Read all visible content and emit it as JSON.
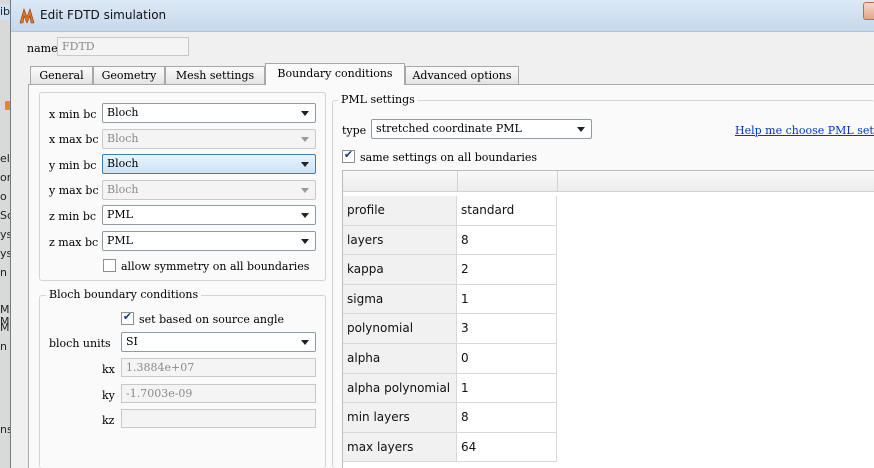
{
  "background_app": {
    "fragments": [
      "ib",
      "el",
      "ore",
      "o",
      "Sc",
      "ys",
      "ys",
      "n",
      "Mo",
      "Mo",
      "M",
      "n",
      "ns"
    ]
  },
  "window": {
    "title": "Edit FDTD simulation",
    "icon": "lumerical-logo-icon",
    "accent": "#e8741e"
  },
  "name_field": {
    "label": "name",
    "value": "FDTD"
  },
  "tabs": [
    {
      "label": "General"
    },
    {
      "label": "Geometry"
    },
    {
      "label": "Mesh settings"
    },
    {
      "label": "Boundary conditions",
      "active": true
    },
    {
      "label": "Advanced options"
    }
  ],
  "boundaries": [
    {
      "label": "x min bc",
      "value": "Bloch",
      "enabled": true,
      "highlighted": false
    },
    {
      "label": "x max bc",
      "value": "Bloch",
      "enabled": false,
      "highlighted": false
    },
    {
      "label": "y min bc",
      "value": "Bloch",
      "enabled": true,
      "highlighted": true
    },
    {
      "label": "y max bc",
      "value": "Bloch",
      "enabled": false,
      "highlighted": false
    },
    {
      "label": "z min bc",
      "value": "PML",
      "enabled": true,
      "highlighted": false
    },
    {
      "label": "z max bc",
      "value": "PML",
      "enabled": true,
      "highlighted": false
    }
  ],
  "allow_symmetry": {
    "label": "allow symmetry on all boundaries",
    "checked": false
  },
  "bloch": {
    "title": "Bloch boundary conditions",
    "set_by_source": {
      "label": "set based on source angle",
      "checked": true
    },
    "units_label": "bloch units",
    "units_value": "SI",
    "kx": {
      "label": "kx",
      "value": "1.3884e+07"
    },
    "ky": {
      "label": "ky",
      "value": "-1.7003e-09"
    },
    "kz": {
      "label": "kz",
      "value": ""
    }
  },
  "pml": {
    "title": "PML settings",
    "type_label": "type",
    "type_value": "stretched coordinate PML",
    "help_link": "Help me choose PML setti",
    "same_settings": {
      "label": "same settings on all boundaries",
      "checked": true
    },
    "rows": [
      {
        "name": "profile",
        "value": "standard"
      },
      {
        "name": "layers",
        "value": "8"
      },
      {
        "name": "kappa",
        "value": "2"
      },
      {
        "name": "sigma",
        "value": "1"
      },
      {
        "name": "polynomial",
        "value": "3"
      },
      {
        "name": "alpha",
        "value": "0"
      },
      {
        "name": "alpha polynomial",
        "value": "1"
      },
      {
        "name": "min layers",
        "value": "8"
      },
      {
        "name": "max layers",
        "value": "64"
      }
    ]
  }
}
